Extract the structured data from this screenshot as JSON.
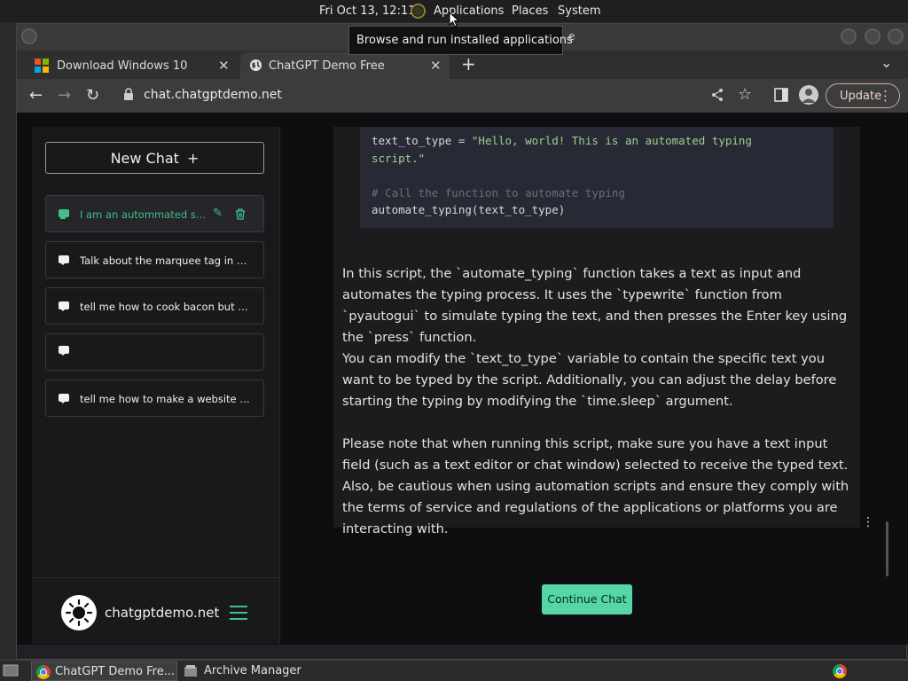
{
  "top_panel": {
    "clock": "Fri Oct 13, 12:11",
    "menus": [
      "Applications",
      "Places",
      "System"
    ],
    "tooltip": "Browse and run installed applications",
    "title_fragment": "e"
  },
  "browser": {
    "tabs": [
      {
        "label": "Download Windows 10",
        "icon": "windows-logo-icon"
      },
      {
        "label": "ChatGPT Demo Free",
        "icon": "globe-icon",
        "active": true
      }
    ],
    "url": "chat.chatgptdemo.net",
    "update_label": "Update"
  },
  "sidebar": {
    "new_chat_label": "New Chat",
    "chats": [
      {
        "text": "I am an autommated script for typing",
        "active": true
      },
      {
        "text": "Talk about the marquee tag in great detail"
      },
      {
        "text": "tell me how to cook bacon but write it like a pirate"
      },
      {
        "text": ""
      },
      {
        "text": "tell me how to make a website but explain like a chef"
      }
    ],
    "brand": "chatgptdemo.net"
  },
  "answer": {
    "code_lines": [
      {
        "text": "text_to_type = \"Hello, world! This is an automated typing",
        "kind": "mixed"
      },
      {
        "text": "script.\"",
        "kind": "str"
      },
      {
        "text": "",
        "kind": "plain"
      },
      {
        "text": "# Call the function to automate typing",
        "kind": "cmt"
      },
      {
        "text": "automate_typing(text_to_type)",
        "kind": "plain"
      }
    ],
    "code_var": "text_to_type = ",
    "code_str1": "\"Hello, world! This is an automated typing",
    "code_str2": "script.\"",
    "code_comment": "# Call the function to automate typing",
    "code_call": "automate_typing(text_to_type)",
    "paragraphs": [
      "In this script, the `automate_typing` function takes a text as input and automates the typing process. It uses the `typewrite` function from `pyautogui` to simulate typing the text, and then presses the Enter key using the `press` function.",
      "You can modify the `text_to_type` variable to contain the specific text you want to be typed by the script. Additionally, you can adjust the delay before starting the typing by modifying the `time.sleep` argument.",
      "Please note that when running this script, make sure you have a text input field (such as a text editor or chat window) selected to receive the typed text. Also, be cautious when using automation scripts and ensure they comply with the terms of service and regulations of the applications or platforms you are interacting with."
    ],
    "continue_label": "Continue Chat"
  },
  "taskbar": {
    "items": [
      "ChatGPT Demo Fre...",
      "Archive Manager"
    ]
  },
  "colors": {
    "accent": "#54d6a5",
    "accent_text": "#3fbf8a",
    "code_bg": "#272a35",
    "update_border": "#d7a5a0"
  }
}
